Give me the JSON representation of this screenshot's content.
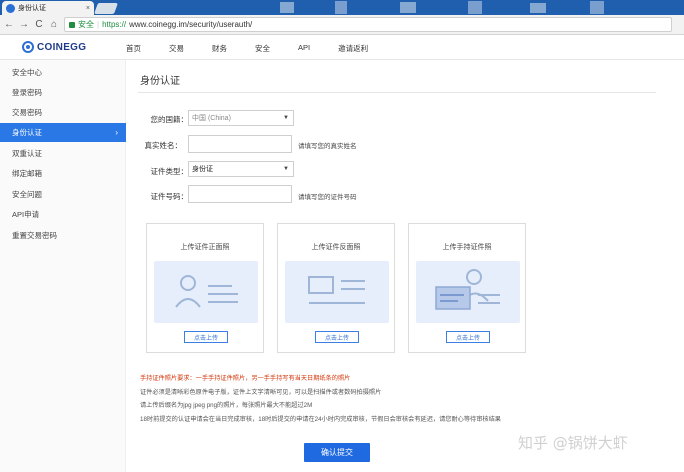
{
  "browser": {
    "tab_title": "身份认证",
    "tab_close": "×",
    "secure_label": "安全",
    "url_scheme": "https://",
    "url_rest": "www.coinegg.im/security/userauth/",
    "nav_back": "←",
    "nav_forward": "→",
    "nav_reload": "C",
    "nav_home": "⌂"
  },
  "header": {
    "logo_text": "COINEGG",
    "nav": [
      "首页",
      "交易",
      "财务",
      "安全",
      "API",
      "邀请返利"
    ]
  },
  "sidebar": {
    "items": [
      "安全中心",
      "登录密码",
      "交易密码",
      "身份认证",
      "双重认证",
      "绑定邮箱",
      "安全问题",
      "API申请",
      "重置交易密码"
    ],
    "active_index": 3,
    "active_chevron": "›"
  },
  "main": {
    "page_title": "身份认证",
    "form": {
      "country_label": "您的国籍：",
      "country_value": "中国 (China)",
      "name_label": "真实姓名：",
      "name_value": "",
      "name_hint": "请填写您的真实姓名",
      "id_type_label": "证件类型：",
      "id_type_value": "身份证",
      "id_number_label": "证件号码：",
      "id_number_value": "",
      "id_number_hint": "请填写您的证件号码",
      "caret": "▼"
    },
    "uploads": [
      {
        "title": "上传证件正面照",
        "button": "点击上传"
      },
      {
        "title": "上传证件反面照",
        "button": "点击上传"
      },
      {
        "title": "上传手持证件照",
        "button": "点击上传"
      }
    ],
    "notes": {
      "red": "手持证件照片要求：一手手持证件照片，另一手手持写有当天日期纸条的照片",
      "lines": [
        "证件必须是清晰彩色原件电子版，证件上文字清晰可见，可以是扫描件或者数码拍摄照片",
        "请上传后缀名为jpg jpeg png的照片，每张照片最大不能超过2M",
        "18时前提交的认证申请会在当日完成审核，18时后提交的申请在24小时内完成审核，节假日会审核会有延迟，请您耐心等待审核结果"
      ]
    },
    "submit_label": "确认提交"
  },
  "watermark": "知乎 @锅饼大虾",
  "colors": {
    "accent": "#2a78e6",
    "brand": "#1f3c88",
    "tabbar": "#1f5fae",
    "warning": "#d4380d"
  }
}
